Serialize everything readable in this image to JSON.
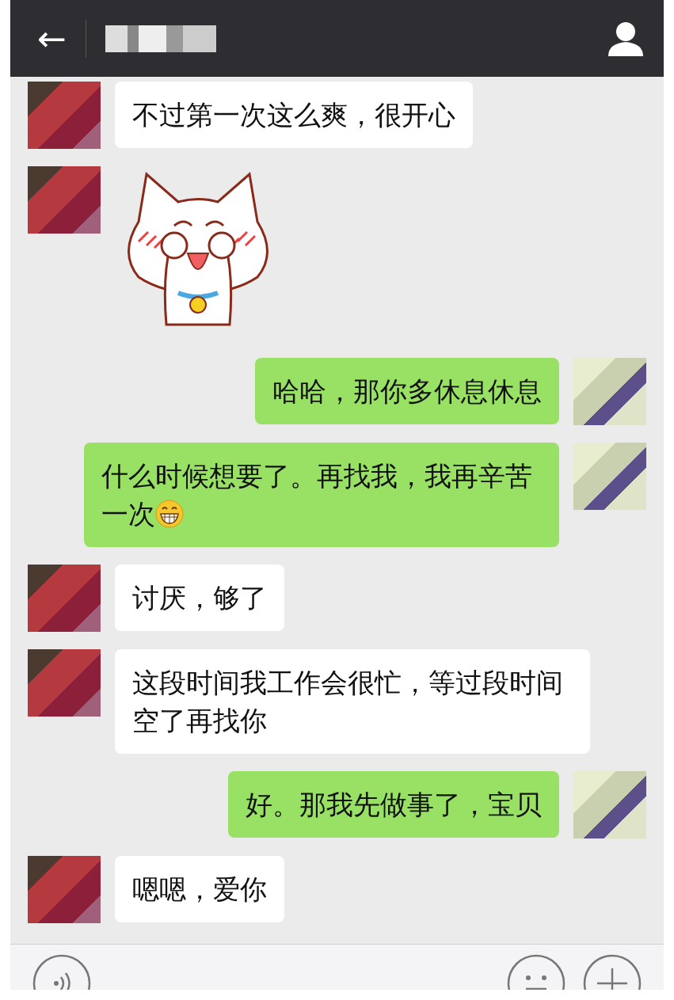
{
  "header": {
    "back_icon": "←"
  },
  "messages": [
    {
      "outgoing": false,
      "kind": "text",
      "text": "不过第一次这么爽，很开心"
    },
    {
      "outgoing": false,
      "kind": "sticker"
    },
    {
      "outgoing": true,
      "kind": "text",
      "text": "哈哈，那你多休息休息"
    },
    {
      "outgoing": true,
      "kind": "text",
      "text": "什么时候想要了。再找我，我再辛苦一次",
      "emoji": true
    },
    {
      "outgoing": false,
      "kind": "text",
      "text": "讨厌，够了"
    },
    {
      "outgoing": false,
      "kind": "text",
      "text": "这段时间我工作会很忙，等过段时间空了再找你"
    },
    {
      "outgoing": true,
      "kind": "text",
      "text": "好。那我先做事了，宝贝"
    },
    {
      "outgoing": false,
      "kind": "text",
      "text": "嗯嗯，爱你"
    }
  ]
}
